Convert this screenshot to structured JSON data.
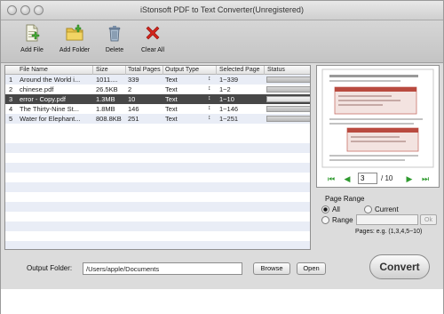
{
  "window": {
    "title": "iStonsoft PDF to Text Converter(Unregistered)"
  },
  "toolbar": {
    "add_file": "Add File",
    "add_folder": "Add Folder",
    "delete": "Delete",
    "clear_all": "Clear All"
  },
  "table": {
    "columns": [
      "File Name",
      "Size",
      "Total Pages",
      "Output Type",
      "Selected Page",
      "Status"
    ],
    "rows": [
      {
        "num": "1",
        "name": "Around the World i...",
        "size": "1011....",
        "pages": "339",
        "type": "Text",
        "selected": "1~339"
      },
      {
        "num": "2",
        "name": "chinese.pdf",
        "size": "26.5KB",
        "pages": "2",
        "type": "Text",
        "selected": "1~2"
      },
      {
        "num": "3",
        "name": "error - Copy.pdf",
        "size": "1.3MB",
        "pages": "10",
        "type": "Text",
        "selected": "1~10"
      },
      {
        "num": "4",
        "name": "The Thirty-Nine St...",
        "size": "1.8MB",
        "pages": "146",
        "type": "Text",
        "selected": "1~146"
      },
      {
        "num": "5",
        "name": "Water for Elephant...",
        "size": "808.8KB",
        "pages": "251",
        "type": "Text",
        "selected": "1~251"
      }
    ]
  },
  "pager": {
    "current": "3",
    "total": "/ 10"
  },
  "page_range": {
    "title": "Page Range",
    "all": "All",
    "current": "Current",
    "range": "Range",
    "ok": "Ok",
    "hint": "Pages: e.g. (1,3,4,5~10)"
  },
  "output": {
    "label": "Output Folder:",
    "path": "/Users/apple/Documents",
    "browse": "Browse",
    "open": "Open"
  },
  "convert": "Convert",
  "colors": {
    "selection": "#474747",
    "stripe": "#e9edf6",
    "nav_green": "#2f9a2f",
    "delete_red": "#d2241c"
  }
}
